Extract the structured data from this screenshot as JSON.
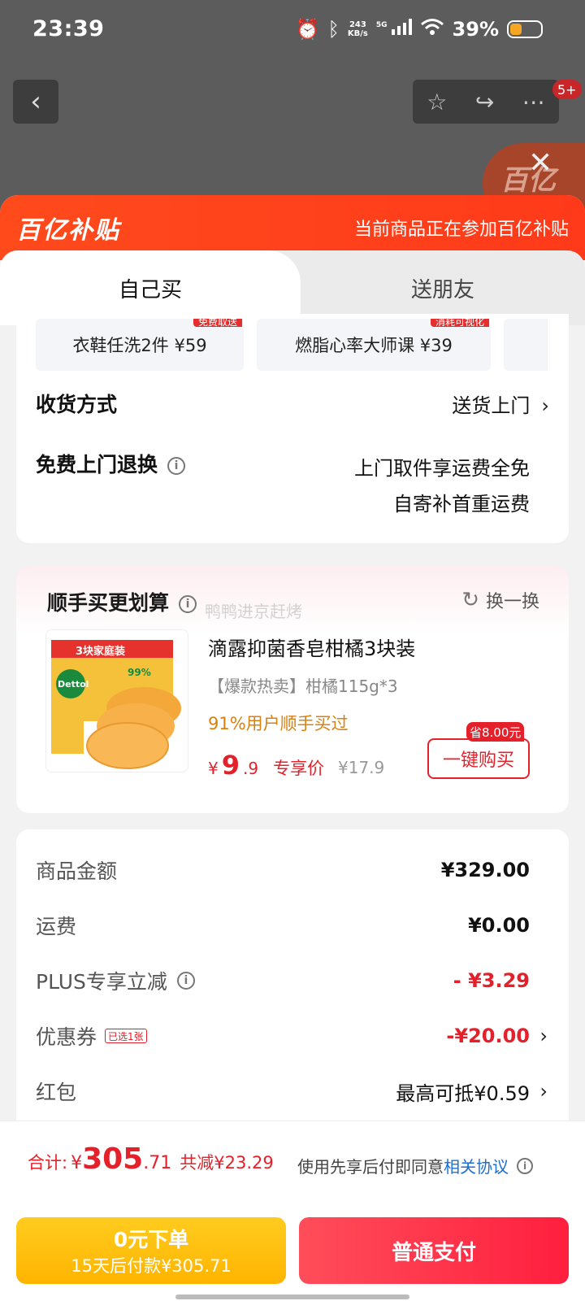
{
  "status_bar": {
    "time": "23:39",
    "speed_value": "243",
    "speed_unit": "KB/s",
    "network": "5G",
    "battery": "39%"
  },
  "header": {
    "message_badge": "5+",
    "floating_badge": "百亿"
  },
  "sheet": {
    "brand": "百亿补贴",
    "note": "当前商品正在参加百亿补贴",
    "tabs": [
      {
        "label": "自己买",
        "active": true
      },
      {
        "label": "送朋友",
        "active": false
      }
    ]
  },
  "services": [
    {
      "label": "衣鞋任洗2件  ¥59",
      "tag": "免费取送"
    },
    {
      "label": "燃脂心率大师课  ¥39",
      "tag": "消耗可视化"
    }
  ],
  "delivery": {
    "label": "收货方式",
    "value": "送货上门"
  },
  "free_return": {
    "label": "免费上门退换",
    "line1": "上门取件享运费全免",
    "line2": "自寄补首重运费"
  },
  "recommend": {
    "title": "顺手买更划算",
    "watermark": "鸭鸭进京赶烤",
    "swap": "换一换",
    "product": {
      "name": "滴露抑菌香皂柑橘3块装",
      "spec": "【爆款热卖】柑橘115g*3",
      "buy_rate": "91%用户顺手买过",
      "price_yen": "¥",
      "price_int": "9",
      "price_dec": ".9",
      "price_label": "专享价",
      "original_price": "¥17.9",
      "save_tag": "省8.00元",
      "buy_button": "一键购买",
      "image_text": {
        "pack": "3块家庭装",
        "brand": "Dettol",
        "pct": "99%"
      }
    }
  },
  "fees": [
    {
      "label": "商品金额",
      "value": "¥329.00"
    },
    {
      "label": "运费",
      "value": "¥0.00"
    },
    {
      "label": "PLUS专享立减",
      "value": "- ¥3.29"
    },
    {
      "label": "优惠券",
      "tag": "已选1张",
      "value": "-¥20.00"
    },
    {
      "label": "红包",
      "value": "最高可抵¥0.59"
    }
  ],
  "bottom": {
    "total_label": "合计:",
    "total_yen": "¥",
    "total_int": "305",
    "total_dec": ".71",
    "total_cut": "共减¥23.29",
    "agree_text": "使用先享后付即同意",
    "agree_link": "相关协议",
    "zero_btn_line1": "0元下单",
    "zero_btn_line2": "15天后付款¥305.71",
    "pay_btn": "普通支付"
  }
}
